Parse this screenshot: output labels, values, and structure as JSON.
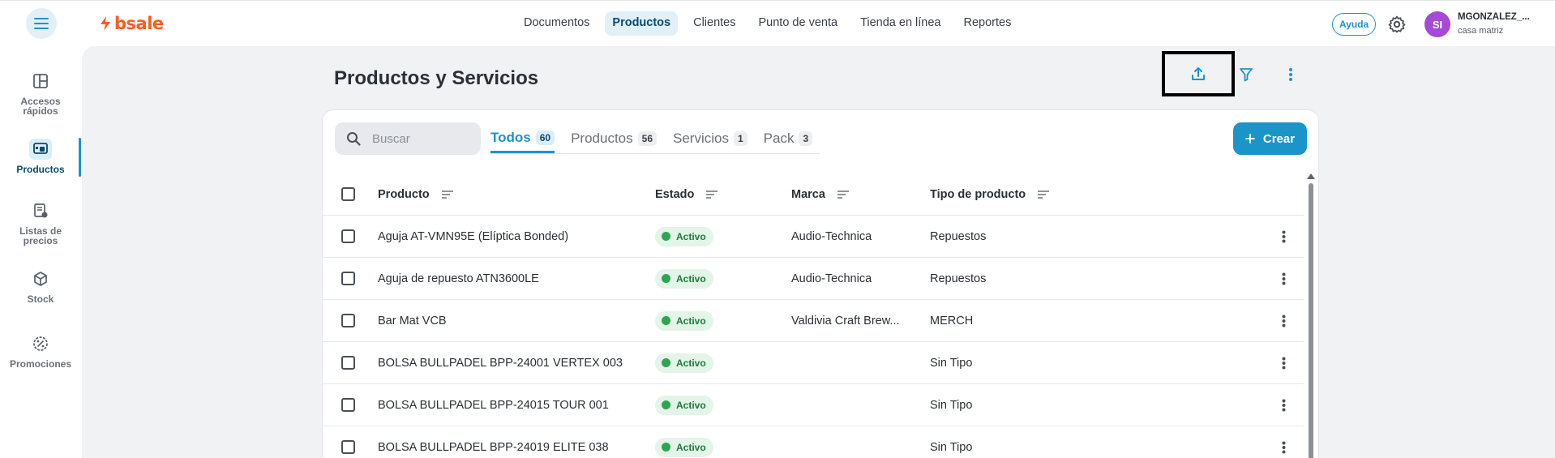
{
  "topbar": {
    "logo_text": "bsale",
    "nav": [
      {
        "label": "Documentos",
        "active": false
      },
      {
        "label": "Productos",
        "active": true
      },
      {
        "label": "Clientes",
        "active": false
      },
      {
        "label": "Punto de venta",
        "active": false
      },
      {
        "label": "Tienda en línea",
        "active": false
      },
      {
        "label": "Reportes",
        "active": false
      }
    ],
    "help_label": "Ayuda",
    "avatar_initials": "SI",
    "user_name": "MGONZALEZ_...",
    "user_branch": "casa matriz"
  },
  "sidebar": {
    "items": [
      {
        "label_line1": "Accesos",
        "label_line2": "rápidos",
        "icon": "grid-icon"
      },
      {
        "label_line1": "Productos",
        "label_line2": "",
        "icon": "products-icon",
        "active": true
      },
      {
        "label_line1": "Listas de",
        "label_line2": "precios",
        "icon": "price-list-icon"
      },
      {
        "label_line1": "Stock",
        "label_line2": "",
        "icon": "box-icon"
      },
      {
        "label_line1": "Promociones",
        "label_line2": "",
        "icon": "promo-icon"
      }
    ]
  },
  "page": {
    "title": "Productos y Servicios"
  },
  "toolbar": {
    "search_placeholder": "Buscar",
    "tabs": [
      {
        "label": "Todos",
        "count": "60",
        "active": true
      },
      {
        "label": "Productos",
        "count": "56",
        "active": false
      },
      {
        "label": "Servicios",
        "count": "1",
        "active": false
      },
      {
        "label": "Pack",
        "count": "3",
        "active": false
      }
    ],
    "create_label": "Crear"
  },
  "table": {
    "columns": [
      "Producto",
      "Estado",
      "Marca",
      "Tipo de producto"
    ],
    "rows": [
      {
        "producto": "Aguja AT-VMN95E (Elíptica Bonded)",
        "estado": "Activo",
        "marca": "Audio-Technica",
        "tipo": "Repuestos"
      },
      {
        "producto": "Aguja de repuesto ATN3600LE",
        "estado": "Activo",
        "marca": "Audio-Technica",
        "tipo": "Repuestos"
      },
      {
        "producto": "Bar Mat VCB",
        "estado": "Activo",
        "marca": "Valdivia Craft Brew...",
        "tipo": "MERCH"
      },
      {
        "producto": "BOLSA BULLPADEL BPP-24001 VERTEX 003",
        "estado": "Activo",
        "marca": "",
        "tipo": "Sin Tipo"
      },
      {
        "producto": "BOLSA BULLPADEL BPP-24015 TOUR 001",
        "estado": "Activo",
        "marca": "",
        "tipo": "Sin Tipo"
      },
      {
        "producto": "BOLSA BULLPADEL BPP-24019 ELITE 038",
        "estado": "Activo",
        "marca": "",
        "tipo": "Sin Tipo"
      }
    ]
  },
  "colors": {
    "accent": "#1b95c8",
    "brand": "#ff5a1f",
    "status_active": "#2fa54f",
    "avatar": "#a649d6"
  }
}
